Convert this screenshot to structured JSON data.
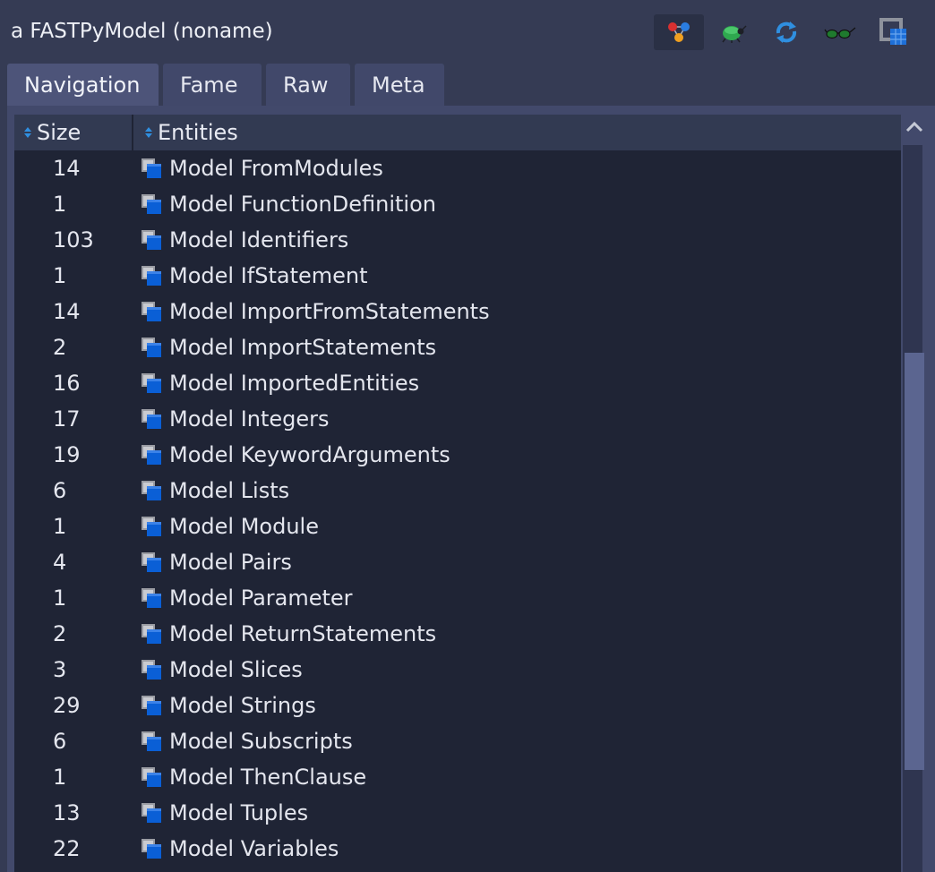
{
  "window": {
    "title": "a FASTPyModel (noname)"
  },
  "toolbar": {
    "icons": [
      "graph-icon",
      "bug-icon",
      "refresh-icon",
      "glasses-icon",
      "layout-icon"
    ]
  },
  "tabs": [
    {
      "label": "Navigation",
      "selected": true
    },
    {
      "label": "Fame",
      "selected": false
    },
    {
      "label": "Raw",
      "selected": false
    },
    {
      "label": "Meta",
      "selected": false
    }
  ],
  "table": {
    "columns": [
      "Size",
      "Entities"
    ],
    "rows": [
      {
        "size": "14",
        "entity": "Model FromModules"
      },
      {
        "size": "1",
        "entity": "Model FunctionDefinition"
      },
      {
        "size": "103",
        "entity": "Model Identifiers"
      },
      {
        "size": "1",
        "entity": "Model IfStatement"
      },
      {
        "size": "14",
        "entity": "Model ImportFromStatements"
      },
      {
        "size": "2",
        "entity": "Model ImportStatements"
      },
      {
        "size": "16",
        "entity": "Model ImportedEntities"
      },
      {
        "size": "17",
        "entity": "Model Integers"
      },
      {
        "size": "19",
        "entity": "Model KeywordArguments"
      },
      {
        "size": "6",
        "entity": "Model Lists"
      },
      {
        "size": "1",
        "entity": "Model Module"
      },
      {
        "size": "4",
        "entity": "Model Pairs"
      },
      {
        "size": "1",
        "entity": "Model Parameter"
      },
      {
        "size": "2",
        "entity": "Model ReturnStatements"
      },
      {
        "size": "3",
        "entity": "Model Slices"
      },
      {
        "size": "29",
        "entity": "Model Strings"
      },
      {
        "size": "6",
        "entity": "Model Subscripts"
      },
      {
        "size": "1",
        "entity": "Model ThenClause"
      },
      {
        "size": "13",
        "entity": "Model Tuples"
      },
      {
        "size": "22",
        "entity": "Model Variables"
      }
    ]
  },
  "colors": {
    "background": "#353b54",
    "table_background": "#1f2435",
    "header_background": "#323a52",
    "tab": "#41486a",
    "tab_selected": "#4d5479",
    "entity_icon_blue": "#0a5fd6",
    "entity_icon_gray": "#9a9ca3"
  }
}
